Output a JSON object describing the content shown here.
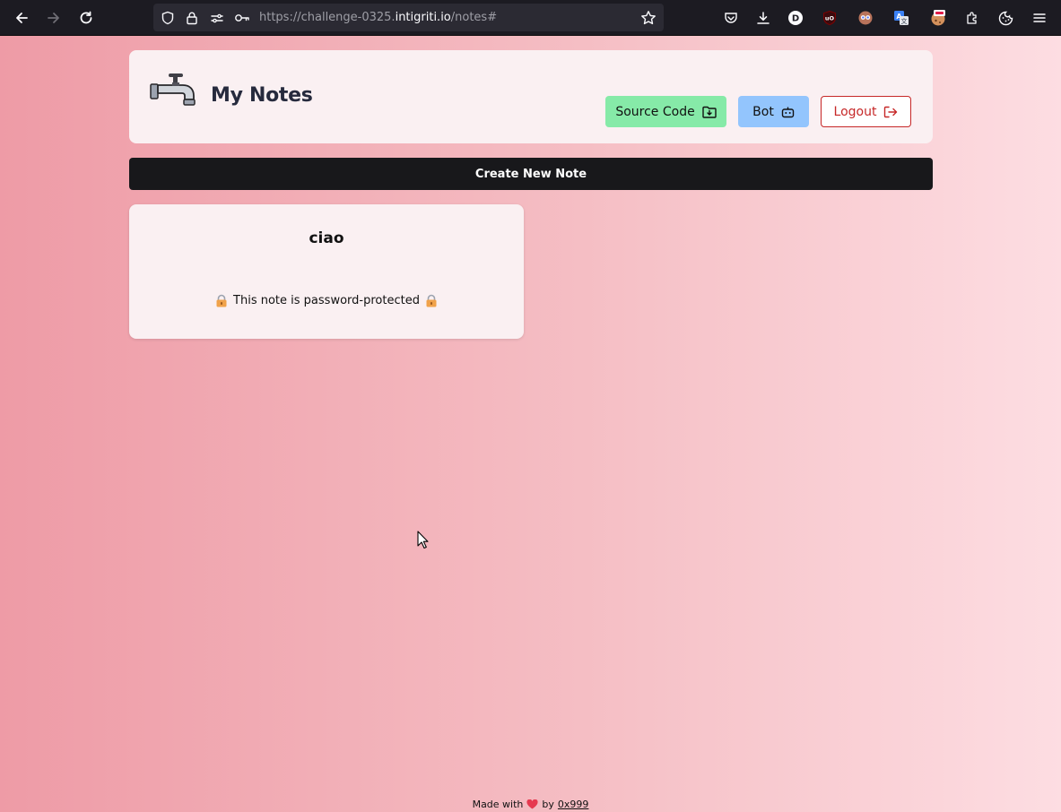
{
  "browser": {
    "url_prefix": "https://challenge-0325.",
    "url_domain": "intigriti.io",
    "url_path": "/notes#",
    "profile_initial": "D"
  },
  "header": {
    "title": "My Notes",
    "buttons": {
      "source_code": "Source Code",
      "bot": "Bot",
      "logout": "Logout"
    }
  },
  "create_note_label": "Create New Note",
  "notes": [
    {
      "title": "ciao",
      "message": "This note is password-protected"
    }
  ],
  "footer": {
    "made_with": "Made with",
    "by": "by",
    "author": "0x999"
  },
  "colors": {
    "source_code_bg": "#86eaa8",
    "bot_bg": "#93c5fd",
    "logout_color": "#c62828",
    "create_bg": "#18181b"
  }
}
